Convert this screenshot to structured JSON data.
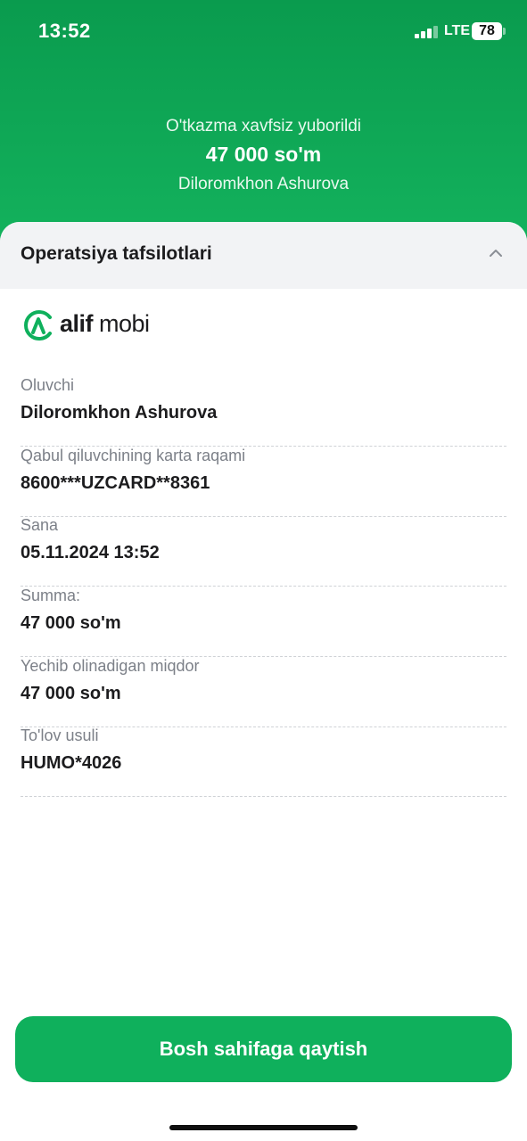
{
  "status_bar": {
    "time": "13:52",
    "network": "LTE",
    "battery": "78"
  },
  "header": {
    "line1": "O'tkazma xavfsiz yuborildi",
    "amount": "47 000 so'm",
    "recipient": "Diloromkhon Ashurova"
  },
  "section": {
    "title": "Operatsiya tafsilotlari"
  },
  "logo": {
    "word1": "alif",
    "word2": " mobi"
  },
  "details": [
    {
      "label": "Oluvchi",
      "value": "Diloromkhon Ashurova"
    },
    {
      "label": "Qabul qiluvchining karta raqami",
      "value": "8600***UZCARD**8361"
    },
    {
      "label": "Sana",
      "value": "05.11.2024 13:52"
    },
    {
      "label": "Summa:",
      "value": "47 000 so'm"
    },
    {
      "label": "Yechib olinadigan miqdor",
      "value": "47 000 so'm"
    },
    {
      "label": "To'lov usuli",
      "value": "HUMO*4026"
    }
  ],
  "button": {
    "label": "Bosh sahifaga qaytish"
  },
  "colors": {
    "brand_green": "#0fb05c",
    "header_green": "#0a9b4e"
  },
  "icons": [
    "signal-icon",
    "battery-icon",
    "chevron-up-icon",
    "alif-logo-icon"
  ]
}
